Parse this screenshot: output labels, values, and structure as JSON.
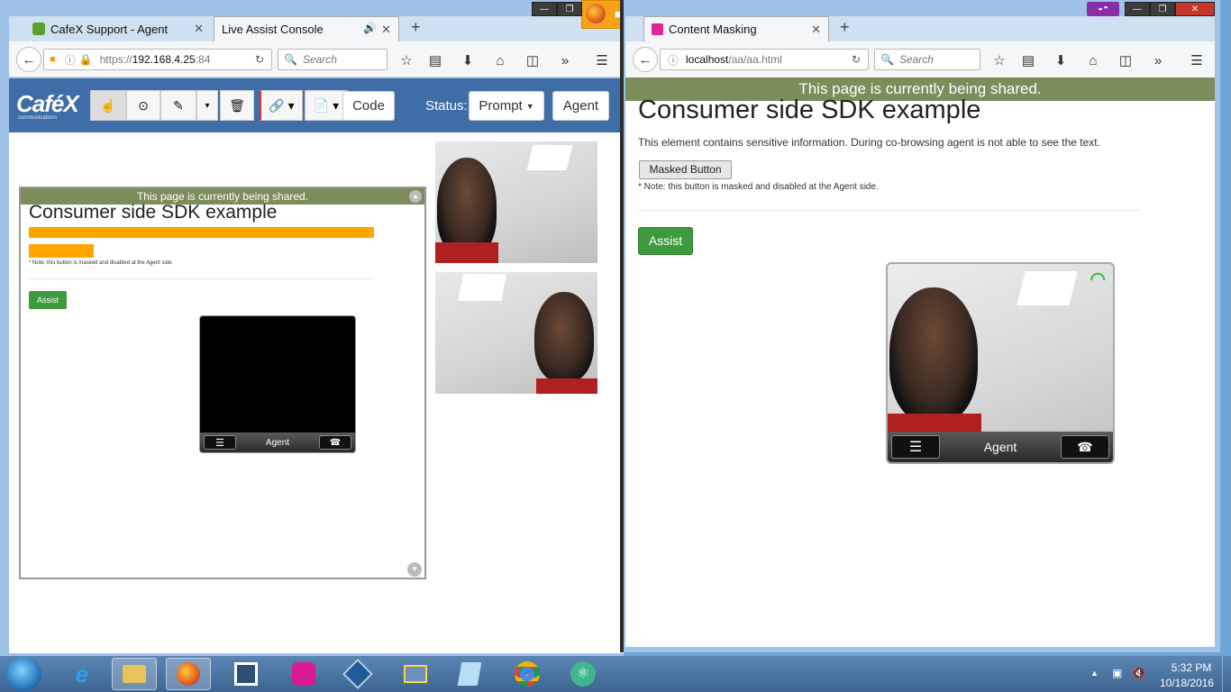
{
  "left_window": {
    "tabs": [
      {
        "label": "CafeX Support - Agent"
      },
      {
        "label": "Live Assist Console"
      }
    ],
    "url": "https://192.168.4.25:84",
    "url_host": "192.168.4.25",
    "url_prefix": "https://",
    "url_port": ":84",
    "search_placeholder": "Search",
    "logo": "CaféX",
    "logo_sub": "communications",
    "code_label": "Code",
    "status_label": "Status:",
    "prompt_label": "Prompt",
    "agent_label": "Agent",
    "shared_banner": "This page is currently being shared.",
    "consumer_title": "Consumer side SDK example",
    "note": "* Note: this button is masked and disabled at the Agent side.",
    "assist_label": "Assist",
    "video_label": "Agent"
  },
  "right_window": {
    "tab_label": "Content Masking",
    "url_host": "localhost",
    "url_path": "/aa/aa.html",
    "search_placeholder": "Search",
    "shared_banner": "This page is currently being shared.",
    "title": "Consumer side SDK example",
    "description": "This element contains sensitive information. During co-browsing agent is not able to see the text.",
    "masked_button": "Masked Button",
    "note": "* Note: this button is masked and disabled at the Agent side.",
    "assist_label": "Assist",
    "video_label": "Agent"
  },
  "taskbar": {
    "time": "5:32 PM",
    "date": "10/18/2016"
  },
  "colors": {
    "cafex_blue": "#3f6da7",
    "banner_green": "#7a8d5a",
    "assist_green": "#3d9a3d",
    "mask_orange": "#ffa500"
  }
}
